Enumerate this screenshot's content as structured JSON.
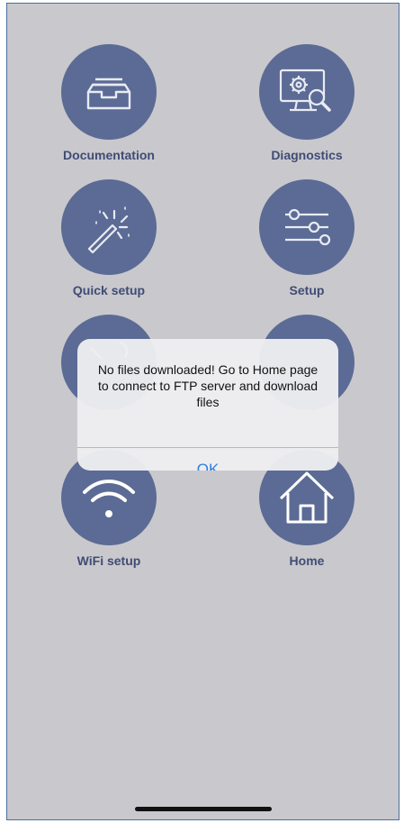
{
  "tiles": [
    {
      "label": "Documentation",
      "icon": "archive-tray-icon"
    },
    {
      "label": "Diagnostics",
      "icon": "monitor-gear-search-icon"
    },
    {
      "label": "Quick setup",
      "icon": "magic-wand-icon"
    },
    {
      "label": "Setup",
      "icon": "sliders-icon"
    },
    {
      "label": "",
      "icon": "tools-icon"
    },
    {
      "label": "",
      "icon": "partial-icon"
    },
    {
      "label": "WiFi setup",
      "icon": "wifi-icon"
    },
    {
      "label": "Home",
      "icon": "house-icon"
    }
  ],
  "alert": {
    "message": "No files downloaded! Go to Home page to connect to FTP server and download files",
    "ok_label": "OK"
  },
  "colors": {
    "background": "#c9c8cc",
    "circle": "#5b6b95",
    "label": "#3f4c75",
    "accent": "#2f7de1"
  }
}
